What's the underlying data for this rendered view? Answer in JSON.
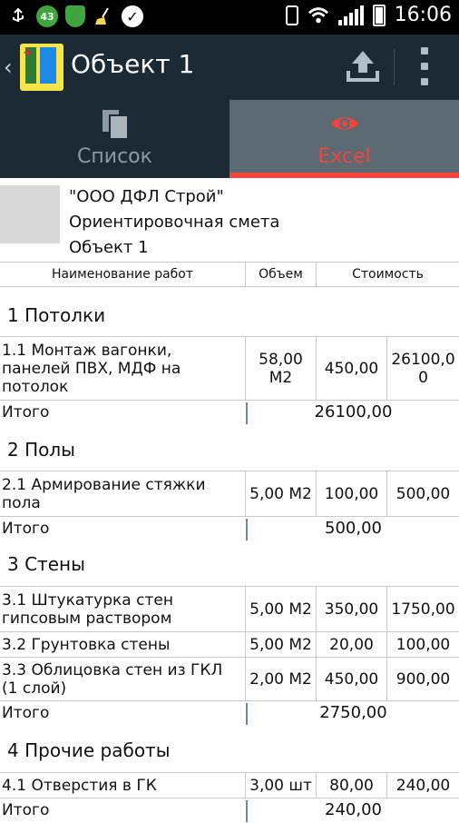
{
  "status_bar": {
    "badge_count": "43",
    "time": "16:06",
    "icons": [
      "usb-icon",
      "badge-icon",
      "shield-icon",
      "broom-icon",
      "check-icon",
      "vibrate-icon",
      "wifi-icon",
      "signal-icon",
      "battery-icon"
    ]
  },
  "app_bar": {
    "title": "Объект 1",
    "icons": [
      "back-icon",
      "app-logo",
      "upload-icon",
      "more-icon"
    ]
  },
  "tabs": [
    {
      "label": "Список",
      "icon": "copy-icon",
      "active": false
    },
    {
      "label": "Excel",
      "icon": "eye-icon",
      "active": true
    }
  ],
  "colors": {
    "accent": "#f0463c",
    "appbar": "#1b2a34",
    "active_tab": "#5b6a73"
  },
  "document": {
    "header": {
      "company": "\"ООО ДФЛ Строй\"",
      "doc_type": "Ориентировочная смета",
      "object": "Объект 1"
    },
    "columns": [
      "Наименование работ",
      "Объем",
      "Стоимость"
    ],
    "total_label": "Итого",
    "sections": [
      {
        "title": "1 Потолки",
        "items": [
          {
            "name": "1.1 Монтаж вагонки, панелей ПВХ, МДФ на потолок",
            "volume": "58,00 М2",
            "price": "450,00",
            "cost": "26100,00"
          }
        ],
        "total": "26100,00"
      },
      {
        "title": "2 Полы",
        "items": [
          {
            "name": "2.1 Армирование стяжки пола",
            "volume": "5,00 М2",
            "price": "100,00",
            "cost": "500,00"
          }
        ],
        "total": "500,00"
      },
      {
        "title": "3 Стены",
        "items": [
          {
            "name": "3.1 Штукатурка стен гипсовым раствором",
            "volume": "5,00 М2",
            "price": "350,00",
            "cost": "1750,00"
          },
          {
            "name": "3.2 Грунтовка стены",
            "volume": "5,00 М2",
            "price": "20,00",
            "cost": "100,00"
          },
          {
            "name": "3.3 Облицовка стен из ГКЛ (1 слой)",
            "volume": "2,00 М2",
            "price": "450,00",
            "cost": "900,00"
          }
        ],
        "total": "2750,00"
      },
      {
        "title": "4 Прочие работы",
        "items": [
          {
            "name": "4.1 Отверстия в ГК",
            "volume": "3,00 шт",
            "price": "80,00",
            "cost": "240,00"
          }
        ],
        "total": "240,00"
      }
    ]
  }
}
